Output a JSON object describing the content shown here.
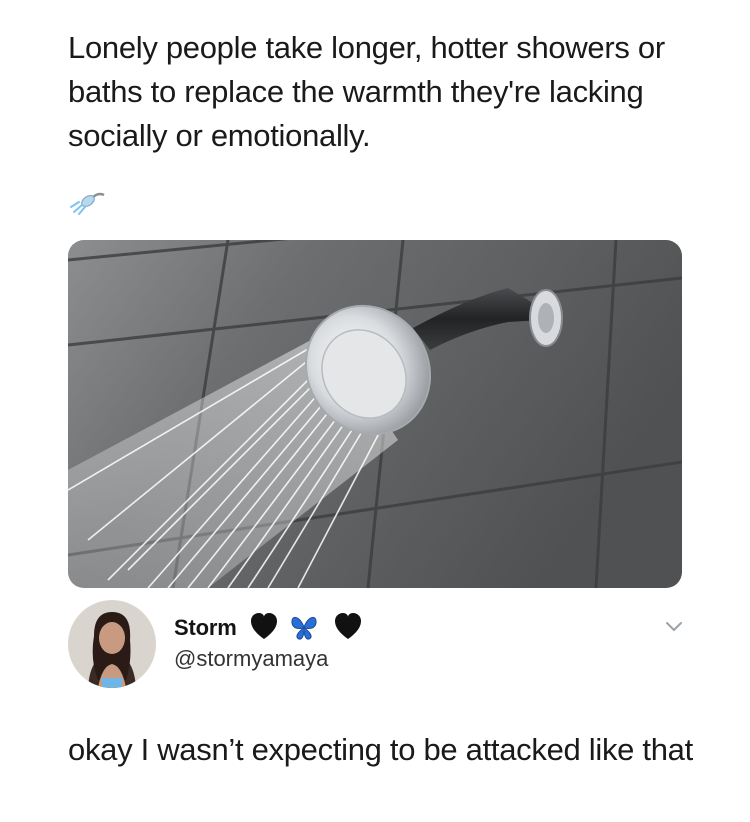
{
  "post": {
    "quote": "Lonely people take longer, hotter showers or baths to replace the warmth they're lacking socially or emotionally.",
    "emoji": "shower-icon",
    "image": "shower-head-photo"
  },
  "author": {
    "display_name": "Storm",
    "name_emojis": [
      "black-heart-icon",
      "butterfly-icon",
      "black-heart-icon"
    ],
    "handle": "@stormyamaya"
  },
  "reply": {
    "text": "okay I wasn’t expecting to be attacked like that"
  },
  "colors": {
    "text": "#1a1a1a",
    "tile": "#5e6062",
    "grout": "#3a3c3e",
    "butterfly": "#2a6fd6"
  }
}
